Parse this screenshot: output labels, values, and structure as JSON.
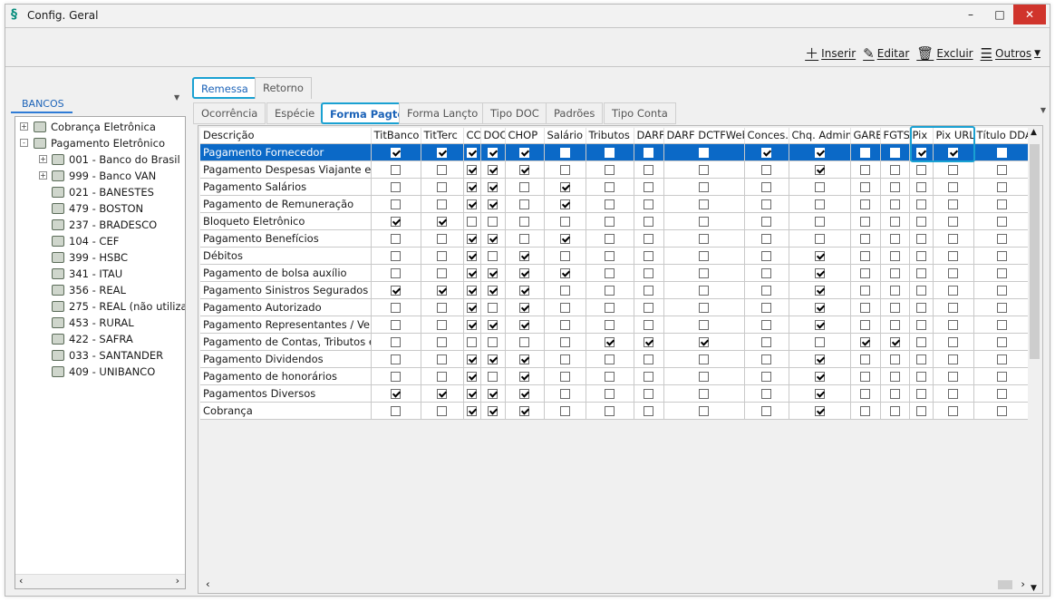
{
  "window": {
    "title": "Config. Geral"
  },
  "toolbar": {
    "insert": "Inserir",
    "edit": "Editar",
    "delete": "Excluir",
    "others": "Outros"
  },
  "left": {
    "panel_title": "BANCOS",
    "tree": [
      {
        "label": "Cobrança Eletrônica",
        "level": 0,
        "expander": "+"
      },
      {
        "label": "Pagamento Eletrônico",
        "level": 0,
        "expander": "-"
      },
      {
        "label": "001 - Banco do Brasil",
        "level": 1,
        "expander": "+"
      },
      {
        "label": "999 - Banco VAN",
        "level": 1,
        "expander": "+"
      },
      {
        "label": "021 - BANESTES",
        "level": 1,
        "expander": ""
      },
      {
        "label": "479 - BOSTON",
        "level": 1,
        "expander": ""
      },
      {
        "label": "237 - BRADESCO",
        "level": 1,
        "expander": ""
      },
      {
        "label": "104 - CEF",
        "level": 1,
        "expander": ""
      },
      {
        "label": "399 - HSBC",
        "level": 1,
        "expander": ""
      },
      {
        "label": "341 - ITAU",
        "level": 1,
        "expander": ""
      },
      {
        "label": "356 - REAL",
        "level": 1,
        "expander": ""
      },
      {
        "label": "275 - REAL (não utiliza",
        "level": 1,
        "expander": ""
      },
      {
        "label": "453 - RURAL",
        "level": 1,
        "expander": ""
      },
      {
        "label": "422 - SAFRA",
        "level": 1,
        "expander": ""
      },
      {
        "label": "033 - SANTANDER",
        "level": 1,
        "expander": ""
      },
      {
        "label": "409 - UNIBANCO",
        "level": 1,
        "expander": ""
      }
    ]
  },
  "tabs_main": [
    "Remessa",
    "Retorno"
  ],
  "tabs_sub": [
    "Ocorrência",
    "Espécie",
    "Forma Pagto",
    "Forma Lançto",
    "Tipo DOC",
    "Padrões",
    "Tipo Conta"
  ],
  "grid": {
    "columns": [
      "Descrição",
      "TitBanco",
      "TitTerc",
      "CC",
      "DOC",
      "CHOP",
      "Salário",
      "Tributos",
      "DARF",
      "DARF DCTFWeb",
      "Conces.",
      "Chq. Admin.",
      "GARE",
      "FGTS",
      "Pix",
      "Pix URL",
      "Título DDA"
    ],
    "rows": [
      {
        "desc": "Pagamento Fornecedor",
        "checks": [
          1,
          1,
          1,
          1,
          1,
          0,
          0,
          0,
          0,
          1,
          1,
          0,
          0,
          1,
          1,
          0
        ]
      },
      {
        "desc": "Pagamento Despesas Viajante em",
        "checks": [
          0,
          0,
          1,
          1,
          1,
          0,
          0,
          0,
          0,
          0,
          1,
          0,
          0,
          0,
          0,
          0
        ]
      },
      {
        "desc": "Pagamento Salários",
        "checks": [
          0,
          0,
          1,
          1,
          0,
          1,
          0,
          0,
          0,
          0,
          0,
          0,
          0,
          0,
          0,
          0
        ]
      },
      {
        "desc": "Pagamento de Remuneração",
        "checks": [
          0,
          0,
          1,
          1,
          0,
          1,
          0,
          0,
          0,
          0,
          0,
          0,
          0,
          0,
          0,
          0
        ]
      },
      {
        "desc": "Bloqueto Eletrônico",
        "checks": [
          1,
          1,
          0,
          0,
          0,
          0,
          0,
          0,
          0,
          0,
          0,
          0,
          0,
          0,
          0,
          0
        ]
      },
      {
        "desc": "Pagamento Benefícios",
        "checks": [
          0,
          0,
          1,
          1,
          0,
          1,
          0,
          0,
          0,
          0,
          0,
          0,
          0,
          0,
          0,
          0
        ]
      },
      {
        "desc": "Débitos",
        "checks": [
          0,
          0,
          1,
          0,
          1,
          0,
          0,
          0,
          0,
          0,
          1,
          0,
          0,
          0,
          0,
          0
        ]
      },
      {
        "desc": "Pagamento de bolsa auxílio",
        "checks": [
          0,
          0,
          1,
          1,
          1,
          1,
          0,
          0,
          0,
          0,
          1,
          0,
          0,
          0,
          0,
          0
        ]
      },
      {
        "desc": "Pagamento Sinistros Segurados",
        "checks": [
          1,
          1,
          1,
          1,
          1,
          0,
          0,
          0,
          0,
          0,
          1,
          0,
          0,
          0,
          0,
          0
        ]
      },
      {
        "desc": "Pagamento Autorizado",
        "checks": [
          0,
          0,
          1,
          0,
          1,
          0,
          0,
          0,
          0,
          0,
          1,
          0,
          0,
          0,
          0,
          0
        ]
      },
      {
        "desc": "Pagamento Representantes / Vend",
        "checks": [
          0,
          0,
          1,
          1,
          1,
          0,
          0,
          0,
          0,
          0,
          1,
          0,
          0,
          0,
          0,
          0
        ]
      },
      {
        "desc": "Pagamento de Contas, Tributos e",
        "checks": [
          0,
          0,
          0,
          0,
          0,
          0,
          1,
          1,
          1,
          0,
          0,
          1,
          1,
          0,
          0,
          0
        ]
      },
      {
        "desc": "Pagamento Dividendos",
        "checks": [
          0,
          0,
          1,
          1,
          1,
          0,
          0,
          0,
          0,
          0,
          1,
          0,
          0,
          0,
          0,
          0
        ]
      },
      {
        "desc": "Pagamento de honorários",
        "checks": [
          0,
          0,
          1,
          0,
          1,
          0,
          0,
          0,
          0,
          0,
          1,
          0,
          0,
          0,
          0,
          0
        ]
      },
      {
        "desc": "Pagamentos Diversos",
        "checks": [
          1,
          1,
          1,
          1,
          1,
          0,
          0,
          0,
          0,
          0,
          1,
          0,
          0,
          0,
          0,
          0
        ]
      },
      {
        "desc": "Cobrança",
        "checks": [
          0,
          0,
          1,
          1,
          1,
          0,
          0,
          0,
          0,
          0,
          1,
          0,
          0,
          0,
          0,
          0
        ]
      }
    ]
  }
}
